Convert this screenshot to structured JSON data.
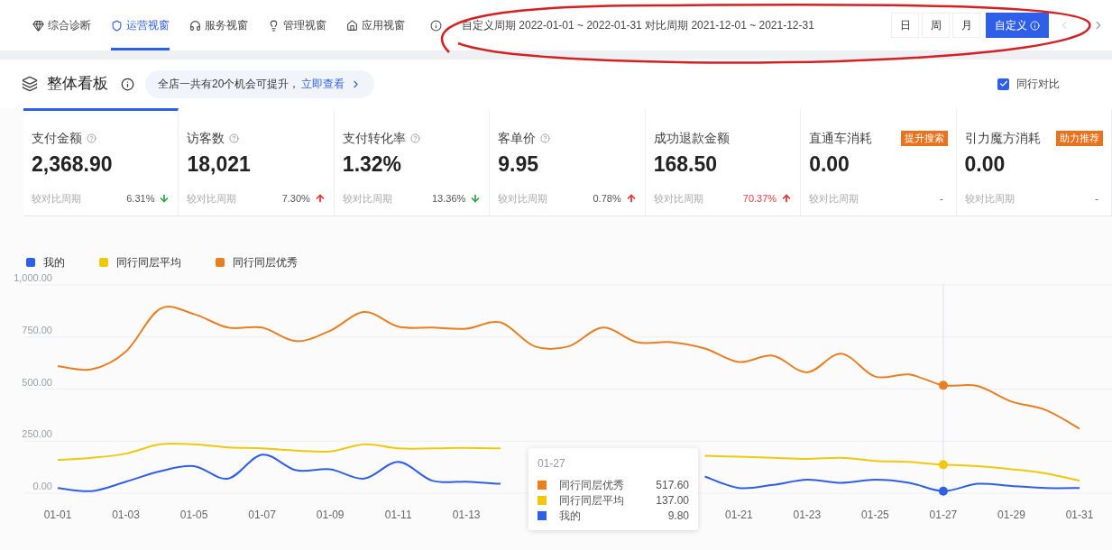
{
  "nav": {
    "tabs": [
      {
        "label": "综合诊断",
        "selected": false
      },
      {
        "label": "运营视窗",
        "selected": true
      },
      {
        "label": "服务视窗",
        "selected": false
      },
      {
        "label": "管理视窗",
        "selected": false
      },
      {
        "label": "应用视窗",
        "selected": false
      }
    ],
    "period": "自定义周期 2022-01-01 ~ 2022-01-31 对比周期 2021-12-01 ~ 2021-12-31",
    "ranges": [
      {
        "label": "日",
        "selected": false
      },
      {
        "label": "周",
        "selected": false
      },
      {
        "label": "月",
        "selected": false
      },
      {
        "label": "自定义",
        "selected": true
      }
    ],
    "prev_disabled": true,
    "next_disabled": false
  },
  "section": {
    "title": "整体看板",
    "tip": "全店一共有20个机会可提升，",
    "tip_link": "立即查看",
    "compare": {
      "label": "同行对比",
      "checked": true
    }
  },
  "metrics": [
    {
      "label": "支付金额",
      "help": true,
      "value": "2,368.90",
      "compare_label": "较对比周期",
      "change": "6.31%",
      "kind": "down",
      "highlight": false,
      "selected": true
    },
    {
      "label": "访客数",
      "help": true,
      "value": "18,021",
      "compare_label": "较对比周期",
      "change": "7.30%",
      "kind": "up",
      "highlight": false,
      "selected": false
    },
    {
      "label": "支付转化率",
      "help": true,
      "value": "1.32%",
      "compare_label": "较对比周期",
      "change": "13.36%",
      "kind": "down",
      "highlight": false,
      "selected": false
    },
    {
      "label": "客单价",
      "help": true,
      "value": "9.95",
      "compare_label": "较对比周期",
      "change": "0.78%",
      "kind": "up",
      "highlight": false,
      "selected": false
    },
    {
      "label": "成功退款金额",
      "help": false,
      "value": "168.50",
      "compare_label": "较对比周期",
      "change": "70.37%",
      "kind": "up",
      "highlight": true,
      "selected": false
    },
    {
      "label": "直通车消耗",
      "help": false,
      "badge": "提升搜索",
      "value": "0.00",
      "compare_label": "较对比周期",
      "change": "-",
      "kind": "none",
      "highlight": false,
      "selected": false
    },
    {
      "label": "引力魔方消耗",
      "help": false,
      "badge": "助力推荐",
      "value": "0.00",
      "compare_label": "较对比周期",
      "change": "-",
      "kind": "none",
      "highlight": false,
      "selected": false
    }
  ],
  "chart": {
    "chart_data": {
      "type": "line",
      "grid": true,
      "legend": "top",
      "ylim": [
        0,
        1000
      ],
      "yticks": [
        {
          "value": 0,
          "label": "0.00"
        },
        {
          "value": 250,
          "label": "250.00"
        },
        {
          "value": 500,
          "label": "500.00"
        },
        {
          "value": 750,
          "label": "750.00"
        },
        {
          "value": 1000,
          "label": "1,000.00"
        }
      ],
      "categories": [
        "01-01",
        null,
        "01-03",
        null,
        "01-05",
        null,
        "01-07",
        null,
        "01-09",
        null,
        "01-11",
        null,
        "01-13",
        null,
        null,
        null,
        null,
        null,
        null,
        null,
        "01-21",
        null,
        "01-23",
        null,
        "01-25",
        null,
        "01-27",
        null,
        "01-29",
        null,
        "01-31"
      ],
      "series": [
        {
          "name": "我的",
          "color": "#2f5fe8",
          "values": [
            25,
            10,
            55,
            105,
            130,
            70,
            185,
            110,
            115,
            70,
            150,
            60,
            55,
            45,
            null,
            null,
            null,
            null,
            null,
            80,
            25,
            40,
            65,
            50,
            65,
            50,
            10,
            45,
            35,
            25,
            25
          ]
        },
        {
          "name": "同行同层平均",
          "color": "#f2c80f",
          "values": [
            160,
            170,
            190,
            235,
            235,
            220,
            215,
            205,
            200,
            235,
            215,
            215,
            218,
            215,
            null,
            null,
            null,
            null,
            null,
            180,
            175,
            170,
            165,
            170,
            155,
            150,
            137,
            130,
            115,
            95,
            60
          ]
        },
        {
          "name": "同行同层优秀",
          "color": "#ea7f22",
          "values": [
            610,
            595,
            680,
            885,
            860,
            795,
            795,
            730,
            780,
            870,
            800,
            795,
            790,
            820,
            705,
            705,
            795,
            725,
            725,
            695,
            630,
            660,
            580,
            670,
            560,
            570,
            518,
            515,
            440,
            400,
            310
          ]
        }
      ]
    },
    "tooltip": {
      "title": "01-27",
      "rows": [
        {
          "name": "同行同层优秀",
          "color": "#ea7f22",
          "value": "517.60"
        },
        {
          "name": "同行同层平均",
          "color": "#f2c80f",
          "value": "137.00"
        },
        {
          "name": "我的",
          "color": "#2f5fe8",
          "value": "9.80"
        }
      ]
    }
  }
}
